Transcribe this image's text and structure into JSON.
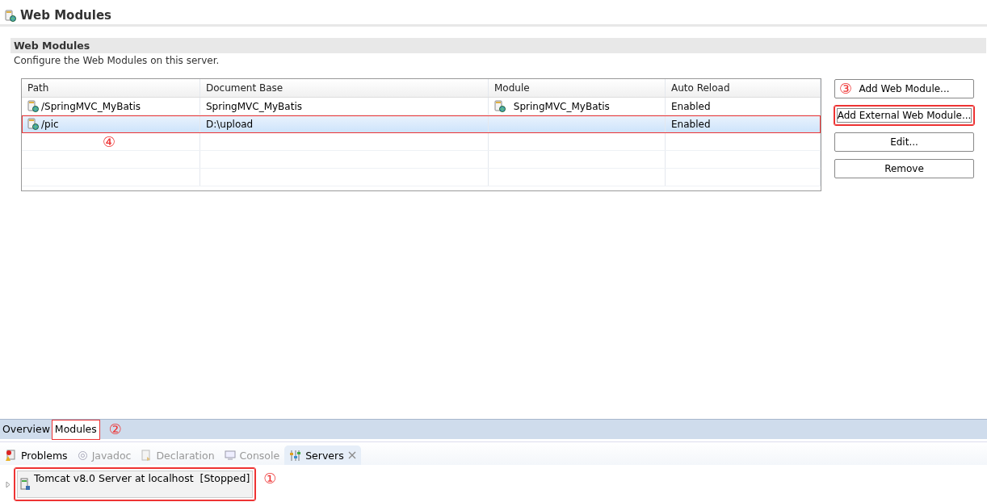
{
  "editor": {
    "title": "Web Modules"
  },
  "section": {
    "title": "Web Modules",
    "description": "Configure the Web Modules on this server."
  },
  "table": {
    "columns": [
      "Path",
      "Document Base",
      "Module",
      "Auto Reload"
    ],
    "rows": [
      {
        "path": "/SpringMVC_MyBatis",
        "document_base": "SpringMVC_MyBatis",
        "module": "SpringMVC_MyBatis",
        "auto_reload": "Enabled",
        "selected": false,
        "highlighted": false
      },
      {
        "path": "/pic",
        "document_base": "D:\\upload",
        "auto_reload": "Enabled",
        "selected": true,
        "highlighted": true,
        "marker": "④"
      }
    ]
  },
  "buttons": [
    {
      "label": "Add Web Module...",
      "highlighted": false,
      "marker": "③"
    },
    {
      "label": "Add External Web Module...",
      "highlighted": true
    },
    {
      "label": "Edit...",
      "highlighted": false
    },
    {
      "label": "Remove",
      "highlighted": false
    }
  ],
  "editor_tabs": [
    {
      "label": "Overview",
      "selected": false,
      "highlighted": false
    },
    {
      "label": "Modules",
      "selected": true,
      "highlighted": true,
      "marker": "②"
    }
  ],
  "view_tabs": [
    {
      "label": "Problems",
      "kind": "problems",
      "selected": false,
      "disabled": false
    },
    {
      "label": "Javadoc",
      "kind": "javadoc",
      "selected": false,
      "disabled": true
    },
    {
      "label": "Declaration",
      "kind": "declaration",
      "selected": false,
      "disabled": true
    },
    {
      "label": "Console",
      "kind": "console",
      "selected": false,
      "disabled": true
    },
    {
      "label": "Servers",
      "kind": "servers",
      "selected": true,
      "disabled": false
    }
  ],
  "servers": [
    {
      "label": "Tomcat v8.0 Server at localhost  [Stopped]",
      "expanded": false,
      "highlighted": true,
      "marker": "①"
    }
  ]
}
